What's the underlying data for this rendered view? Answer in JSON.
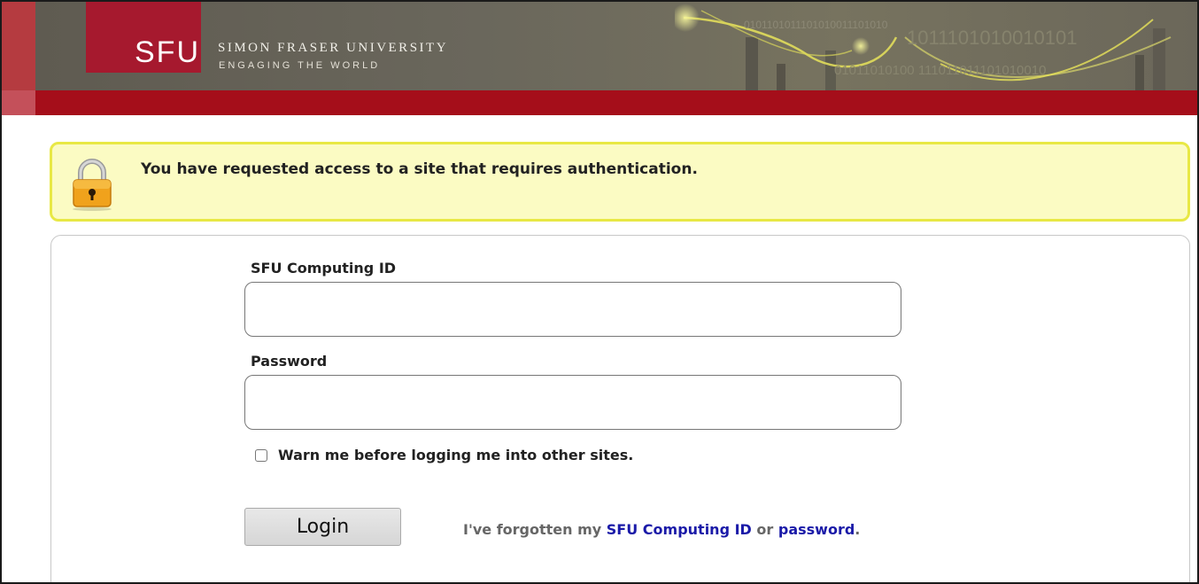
{
  "header": {
    "logo_text": "SFU",
    "university_name": "SIMON FRASER UNIVERSITY",
    "tagline": "ENGAGING THE WORLD",
    "binary_line_1": "0101101011101010011101010",
    "binary_line_2": "1011101010010101",
    "binary_line_3": "01011010100 111011011101010010"
  },
  "notice": {
    "icon": "lock-icon",
    "message": "You have requested access to a site that requires authentication."
  },
  "form": {
    "id_label": "SFU Computing ID",
    "id_value": "",
    "password_label": "Password",
    "password_value": "",
    "warn_checkbox_label": "Warn me before logging me into other sites.",
    "warn_checked": false,
    "login_button": "Login",
    "forgot_prefix": "I've forgotten my",
    "forgot_id_link": "SFU Computing ID",
    "forgot_or": "or",
    "forgot_password_link": "password",
    "forgot_suffix": "."
  },
  "colors": {
    "brand_red": "#a6192e",
    "header_gray": "#6a675c",
    "notice_bg": "#fbfbc3",
    "notice_border": "#e8e845",
    "link_blue": "#1a1aa8"
  }
}
